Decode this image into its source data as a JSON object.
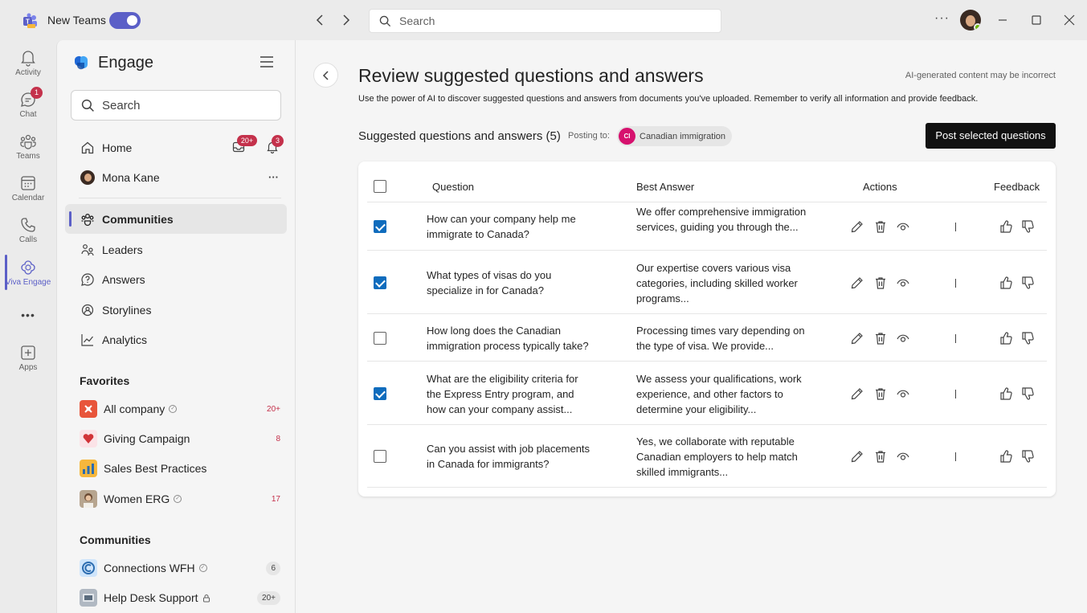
{
  "titlebar": {
    "app_name": "New Teams",
    "search_placeholder": "Search"
  },
  "rail": {
    "items": [
      {
        "label": "Activity",
        "icon": "bell-icon"
      },
      {
        "label": "Chat",
        "icon": "chat-icon",
        "badge": "1"
      },
      {
        "label": "Teams",
        "icon": "teams-icon"
      },
      {
        "label": "Calendar",
        "icon": "calendar-icon"
      },
      {
        "label": "Calls",
        "icon": "phone-icon"
      },
      {
        "label": "Viva Engage",
        "icon": "engage-icon"
      },
      {
        "label": "Apps",
        "icon": "add-app-icon"
      }
    ],
    "more_label": "•••"
  },
  "panel": {
    "title": "Engage",
    "search_placeholder": "Search",
    "home_label": "Home",
    "home_badge_inbox": "20+",
    "home_badge_bell": "3",
    "profile_name": "Mona Kane",
    "profile_more": "···",
    "nav": [
      {
        "label": "Communities",
        "icon": "communities-icon"
      },
      {
        "label": "Leaders",
        "icon": "leaders-icon"
      },
      {
        "label": "Answers",
        "icon": "answers-icon"
      },
      {
        "label": "Storylines",
        "icon": "storylines-icon"
      },
      {
        "label": "Analytics",
        "icon": "analytics-icon"
      }
    ],
    "favorites_title": "Favorites",
    "favorites": [
      {
        "name": "All company",
        "count": "20+",
        "color": "#e8553b"
      },
      {
        "name": "Giving Campaign",
        "count": "8",
        "color": "#fbe3e7"
      },
      {
        "name": "Sales Best Practices",
        "count": "",
        "color": "#f6b73c"
      },
      {
        "name": "Women ERG",
        "count": "17",
        "color": "#b7a58f"
      }
    ],
    "communities_title": "Communities",
    "communities": [
      {
        "name": "Connections WFH",
        "count": "6",
        "color": "#cfe5fb"
      },
      {
        "name": "Help Desk Support",
        "count": "20+",
        "color": "#b0b8c2"
      }
    ]
  },
  "main": {
    "title": "Review suggested questions and answers",
    "ai_note": "AI-generated content may be incorrect",
    "description": "Use the power of AI to discover suggested questions and answers from documents you've uploaded. Remember to verify all information and provide feedback.",
    "subtitle": "Suggested questions and answers (5)",
    "posting_to": "Posting to:",
    "community_initials": "CI",
    "community_name": "Canadian immigration",
    "post_button": "Post selected questions",
    "columns": {
      "question": "Question",
      "answer": "Best Answer",
      "actions": "Actions",
      "feedback": "Feedback"
    },
    "rows": [
      {
        "checked": true,
        "question": " How can your company help me immigrate to Canada?",
        "answer": "We offer comprehensive immigration services, guiding you through the..."
      },
      {
        "checked": true,
        "question": "What types of visas do you specialize in for Canada?",
        "answer": "Our expertise covers various visa categories, including skilled worker programs..."
      },
      {
        "checked": false,
        "question": "How long does the Canadian immigration process typically take?",
        "answer": "Processing times vary depending on the type of visa. We provide..."
      },
      {
        "checked": true,
        "question": "What are the eligibility criteria for the Express Entry program, and how can your company assist...",
        "answer": "We assess your qualifications, work experience, and other factors to determine your eligibility..."
      },
      {
        "checked": false,
        "question": "Can you assist with job placements in Canada for immigrants?",
        "answer": " Yes, we collaborate with reputable Canadian employers to help match skilled immigrants..."
      }
    ]
  }
}
